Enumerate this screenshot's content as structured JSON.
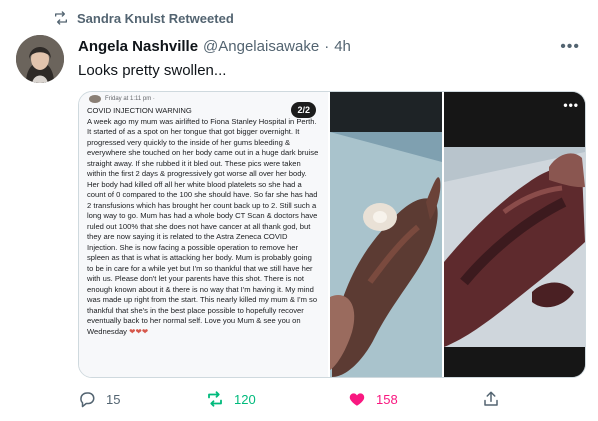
{
  "retweet_context": {
    "text": "Sandra Knulst Retweeted",
    "icon": "retweet-icon"
  },
  "author": {
    "name": "Angela Nashville",
    "handle": "@Angelaisawake",
    "separator": "·",
    "time": "4h"
  },
  "more_icon": "more-horizontal-icon",
  "tweet": {
    "text": "Looks pretty swollen..."
  },
  "media": {
    "screenshot": {
      "header_time": "Friday at 1:11 pm ·",
      "page_badge": "2/2",
      "body": "COVID INJECTION WARNING\nA week ago my mum was airlifted to Fiona Stanley Hospital in Perth. It started of as a spot on her tongue that got bigger overnight. It progressed very quickly to the inside of her gums bleeding & everywhere she touched on her body came out in a huge dark bruise straight away. If she rubbed it it bled out. These pics were taken within the first 2 days & progressively got worse all over her body. Her body had killed off all her white blood platelets so she had a count of 0 compared to the 100 she should have. So far she has had 2 transfusions which has brought her count back up to 2. Still such a long way to go. Mum has had a whole body CT Scan & doctors have ruled out 100% that she does not have cancer at all thank god, but they are now saying it is related to the Astra Zeneca COVID Injection. She is now facing a possible operation to remove her spleen as that is what is attacking her body. Mum is probably going to be in care for a while yet but I'm so thankful that we still have her with us. Please don't let your parents have this shot. There is not enough known about it & there is no way that I'm having it. My mind was made up right from the start. This nearly killed my mum & I'm so thankful that she's in the best place possible to hopefully recover eventually back to her normal self. Love you Mum & see you on Wednesday",
      "hearts": "❤❤❤"
    },
    "photo_2_menu_icon": "more-vertical-icon"
  },
  "actions": {
    "reply": {
      "icon": "reply-icon",
      "count": "15"
    },
    "retweet": {
      "icon": "retweet-icon",
      "count": "120",
      "color": "#00ba7c"
    },
    "like": {
      "icon": "heart-icon",
      "count": "158",
      "color": "#f91880"
    },
    "share": {
      "icon": "share-icon"
    }
  }
}
